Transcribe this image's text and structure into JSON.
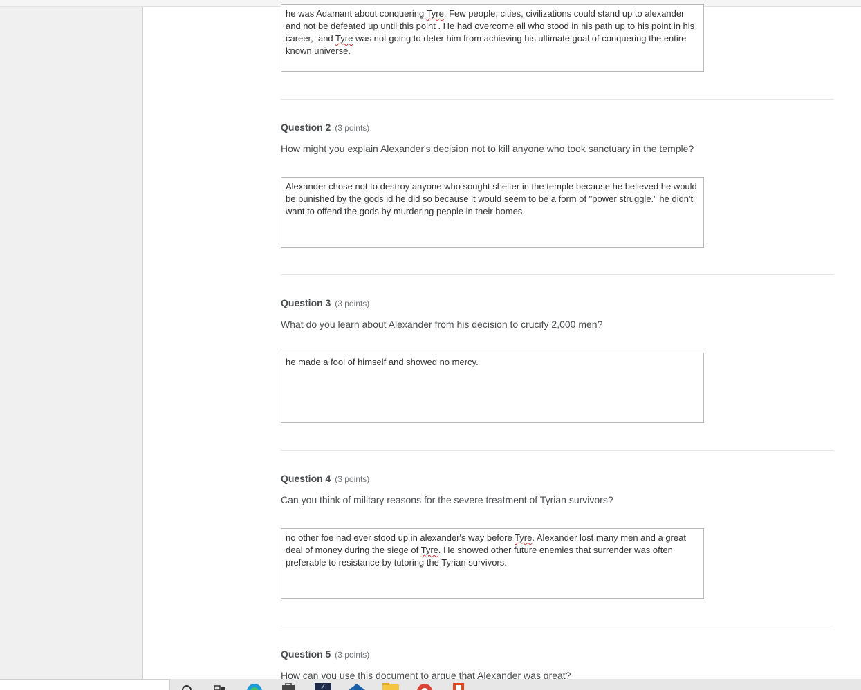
{
  "answers": {
    "q1_tail": "he was Adamant about conquering Tyre. Few people, cities, civilizations could stand up to alexander and not be defeated up until this point . He had overcome all who stood in his path up to his point in his career,  and Tyre was not going to deter him from achieving his ultimate goal of conquering the entire known universe.",
    "q2": "Alexander chose not to destroy anyone who sought shelter in the temple because he believed he would be punished by the gods id he did so because it would seem to be a form of \"power struggle.\" he didn't want to offend the gods by murdering people in their homes.",
    "q3": "he made a fool of himself and showed no mercy.",
    "q4": "no other foe had ever stood up in alexander's way before Tyre. Alexander lost many men and a great deal of money during the siege of Tyre. He showed other future enemies that surrender was often preferable to resistance by tutoring the Tyrian survivors."
  },
  "questions": [
    {
      "label": "Question 2",
      "points": "(3 points)",
      "text": "How might you explain Alexander's decision not to kill anyone who took sanctuary in the temple?"
    },
    {
      "label": "Question 3",
      "points": "(3 points)",
      "text": "What do you learn about Alexander from his decision to crucify 2,000 men?"
    },
    {
      "label": "Question 4",
      "points": "(3 points)",
      "text": "Can you think of military reasons for the severe treatment of Tyrian survivors?"
    },
    {
      "label": "Question 5",
      "points": "(3 points)",
      "text": "How can you use this document to argue that Alexander was great?"
    }
  ],
  "colors": {
    "spellcheck": "#d9302c",
    "text": "#494c4e",
    "border": "#b9b9b9",
    "sidebar": "#f0f0f0"
  },
  "taskbar_icons": [
    "search-icon",
    "task-view-icon",
    "edge-icon",
    "store-icon",
    "app-icon",
    "mail-icon",
    "file-explorer-icon",
    "chrome-icon",
    "office-icon"
  ]
}
